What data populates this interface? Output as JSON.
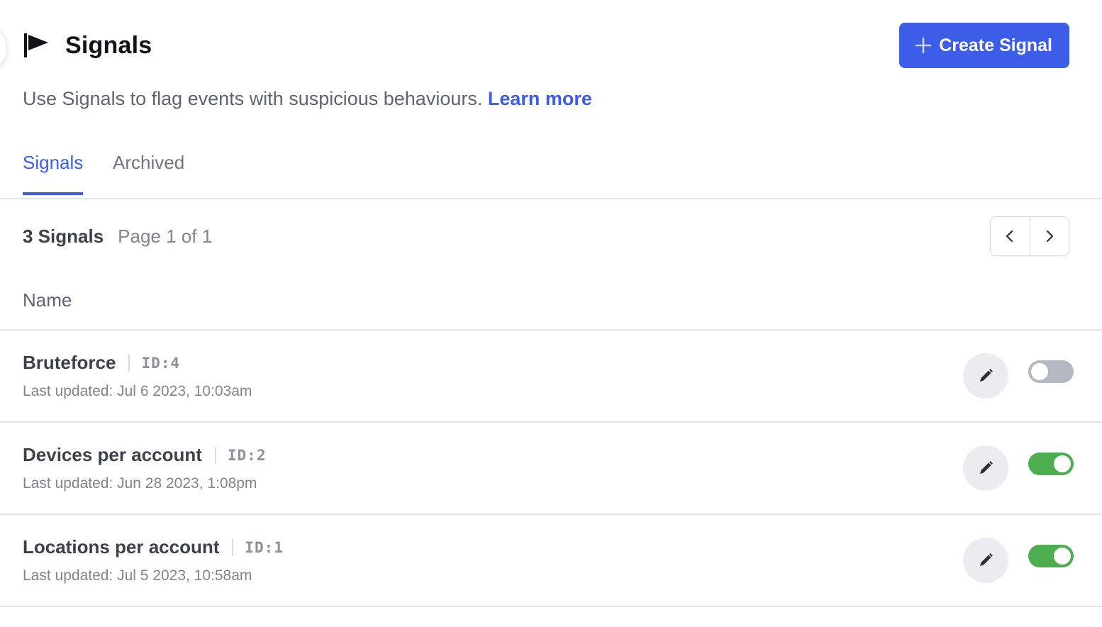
{
  "header": {
    "title": "Signals",
    "icon": "flag-icon",
    "create_button_label": "Create Signal",
    "create_button_icon": "plus-icon"
  },
  "description": {
    "text": "Use Signals to flag events with suspicious behaviours.",
    "link_label": "Learn more"
  },
  "tabs": [
    {
      "label": "Signals",
      "active": true
    },
    {
      "label": "Archived",
      "active": false
    }
  ],
  "summary": {
    "count_label": "3 Signals",
    "page_label": "Page 1 of 1"
  },
  "pagination": {
    "prev_icon": "chevron-left-icon",
    "next_icon": "chevron-right-icon"
  },
  "table": {
    "column_name": "Name",
    "rows": [
      {
        "name": "Bruteforce",
        "id": "ID:4",
        "updated": "Last updated: Jul 6 2023, 10:03am",
        "enabled": false
      },
      {
        "name": "Devices per account",
        "id": "ID:2",
        "updated": "Last updated: Jun 28 2023, 1:08pm",
        "enabled": true
      },
      {
        "name": "Locations per account",
        "id": "ID:1",
        "updated": "Last updated: Jul 5 2023, 10:58am",
        "enabled": true
      }
    ]
  },
  "colors": {
    "accent": "#3b5de7",
    "toggle_on": "#4cae4f",
    "toggle_off": "#b4b8c1"
  }
}
